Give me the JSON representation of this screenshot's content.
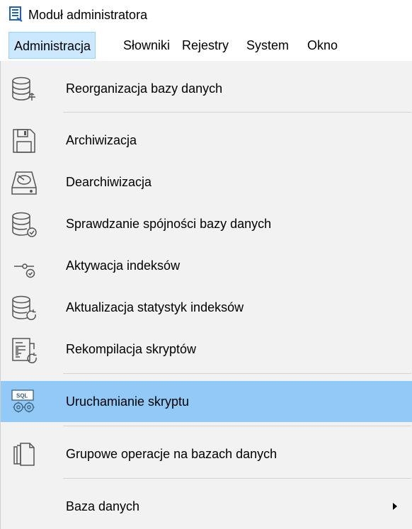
{
  "window": {
    "title": "Moduł administratora",
    "icon": "app-module-icon",
    "accent_color": "#1f5fbf"
  },
  "menubar": {
    "items": [
      {
        "label": "Administracja",
        "active": true
      },
      {
        "label": "Słowniki"
      },
      {
        "label": "Rejestry"
      },
      {
        "label": "System"
      },
      {
        "label": "Okno"
      }
    ]
  },
  "menu": {
    "highlight_color": "#91c9f7",
    "items": [
      {
        "label": "Reorganizacja bazy danych",
        "icon": "database-reorganize-icon"
      },
      {
        "label": "Archiwizacja",
        "icon": "floppy-disk-icon"
      },
      {
        "label": "Dearchiwizacja",
        "icon": "disk-restore-icon"
      },
      {
        "label": "Sprawdzanie spójności bazy danych",
        "icon": "database-check-icon"
      },
      {
        "label": "Aktywacja indeksów",
        "icon": "index-activate-icon"
      },
      {
        "label": "Aktualizacja statystyk indeksów",
        "icon": "database-refresh-icon"
      },
      {
        "label": "Rekompilacja skryptów",
        "icon": "script-recompile-icon"
      },
      {
        "label": "Uruchamianie skryptu",
        "icon": "sql-run-script-icon",
        "highlighted": true
      },
      {
        "label": "Grupowe operacje na bazach danych",
        "icon": "copy-pages-icon"
      },
      {
        "label": "Baza danych",
        "icon": "submenu-arrow-icon",
        "has_submenu": true
      }
    ]
  }
}
